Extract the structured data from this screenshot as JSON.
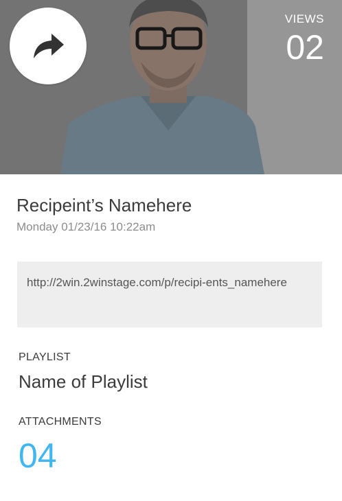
{
  "hero": {
    "views_label": "VIEWS",
    "views_count": "02"
  },
  "recipient": {
    "name": "Recipeint’s Namehere",
    "date": "Monday 01/23/16 10:22am"
  },
  "link": {
    "url": "http://2win.2winstage.com/p/recipi-ents_namehere"
  },
  "playlist": {
    "label": "PLAYLIST",
    "name": "Name of Playlist"
  },
  "attachments": {
    "label": "ATTACHMENTS",
    "count": "04"
  },
  "colors": {
    "accent": "#42b6f0",
    "text": "#3b3b3b",
    "muted": "#8c8c8c",
    "link_box_bg": "#eeeeee"
  },
  "icons": {
    "share": "share-arrow-icon"
  }
}
